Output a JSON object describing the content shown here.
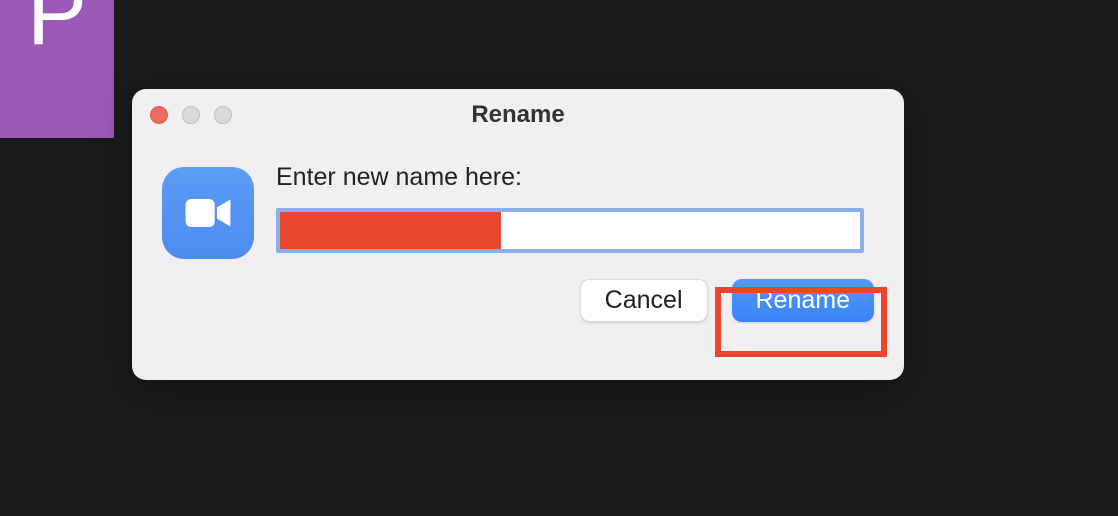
{
  "avatar": {
    "letter": "P",
    "bg_color": "#9b59b6"
  },
  "dialog": {
    "title": "Rename",
    "prompt": "Enter new name here:",
    "app_icon_name": "zoom-video-icon",
    "input_value_redacted": true,
    "buttons": {
      "cancel": "Cancel",
      "confirm": "Rename"
    }
  },
  "colors": {
    "redaction": "#e9462f",
    "highlight": "#e9462f",
    "accent": "#3b82f6"
  }
}
